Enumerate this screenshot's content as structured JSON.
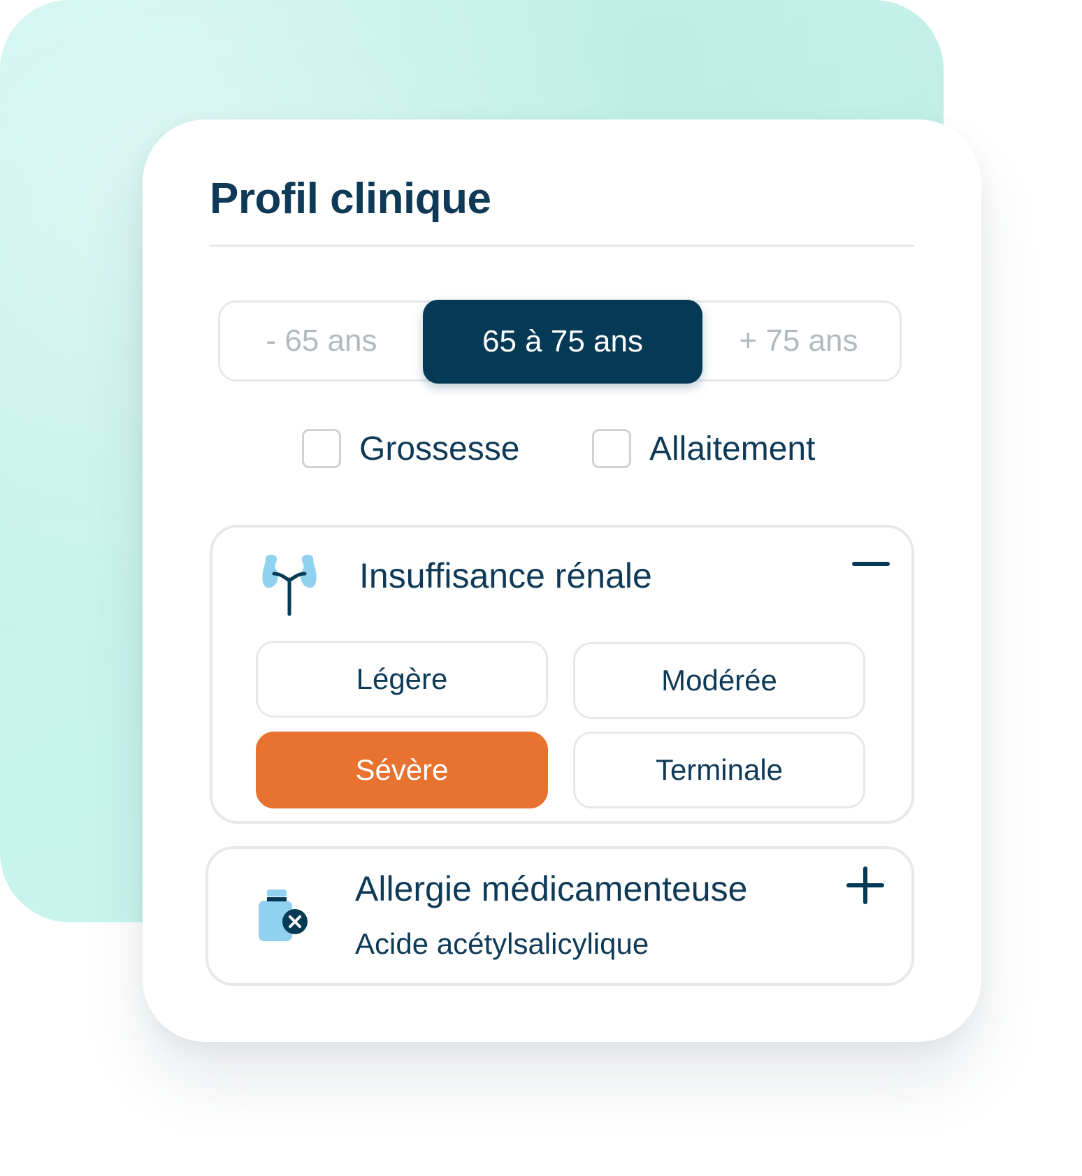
{
  "card": {
    "title": "Profil clinique"
  },
  "age_filter": {
    "options": [
      "- 65 ans",
      "65 à 75 ans",
      "+ 75 ans"
    ],
    "selected": "65 à 75 ans"
  },
  "conditions": [
    {
      "label": "Grossesse",
      "checked": false
    },
    {
      "label": "Allaitement",
      "checked": false
    }
  ],
  "renal_section": {
    "title": "Insuffisance rénale",
    "icon": "kidney-icon",
    "toggle_icon": "minus-icon",
    "levels": [
      "Légère",
      "Modérée",
      "Sévère",
      "Terminale"
    ],
    "selected": "Sévère"
  },
  "allergy_section": {
    "title": "Allergie médicamenteuse",
    "subtitle": "Acide acétylsalicylique",
    "icon": "medicine-bottle-x-icon",
    "toggle_icon": "plus-icon"
  },
  "colors": {
    "navy": "#053a57",
    "text": "#0f3a57",
    "accent_orange": "#e8722f",
    "icon_light_blue": "#8fd1ef",
    "background_mint": "#cdf4ef",
    "border": "#e6e8eb"
  }
}
